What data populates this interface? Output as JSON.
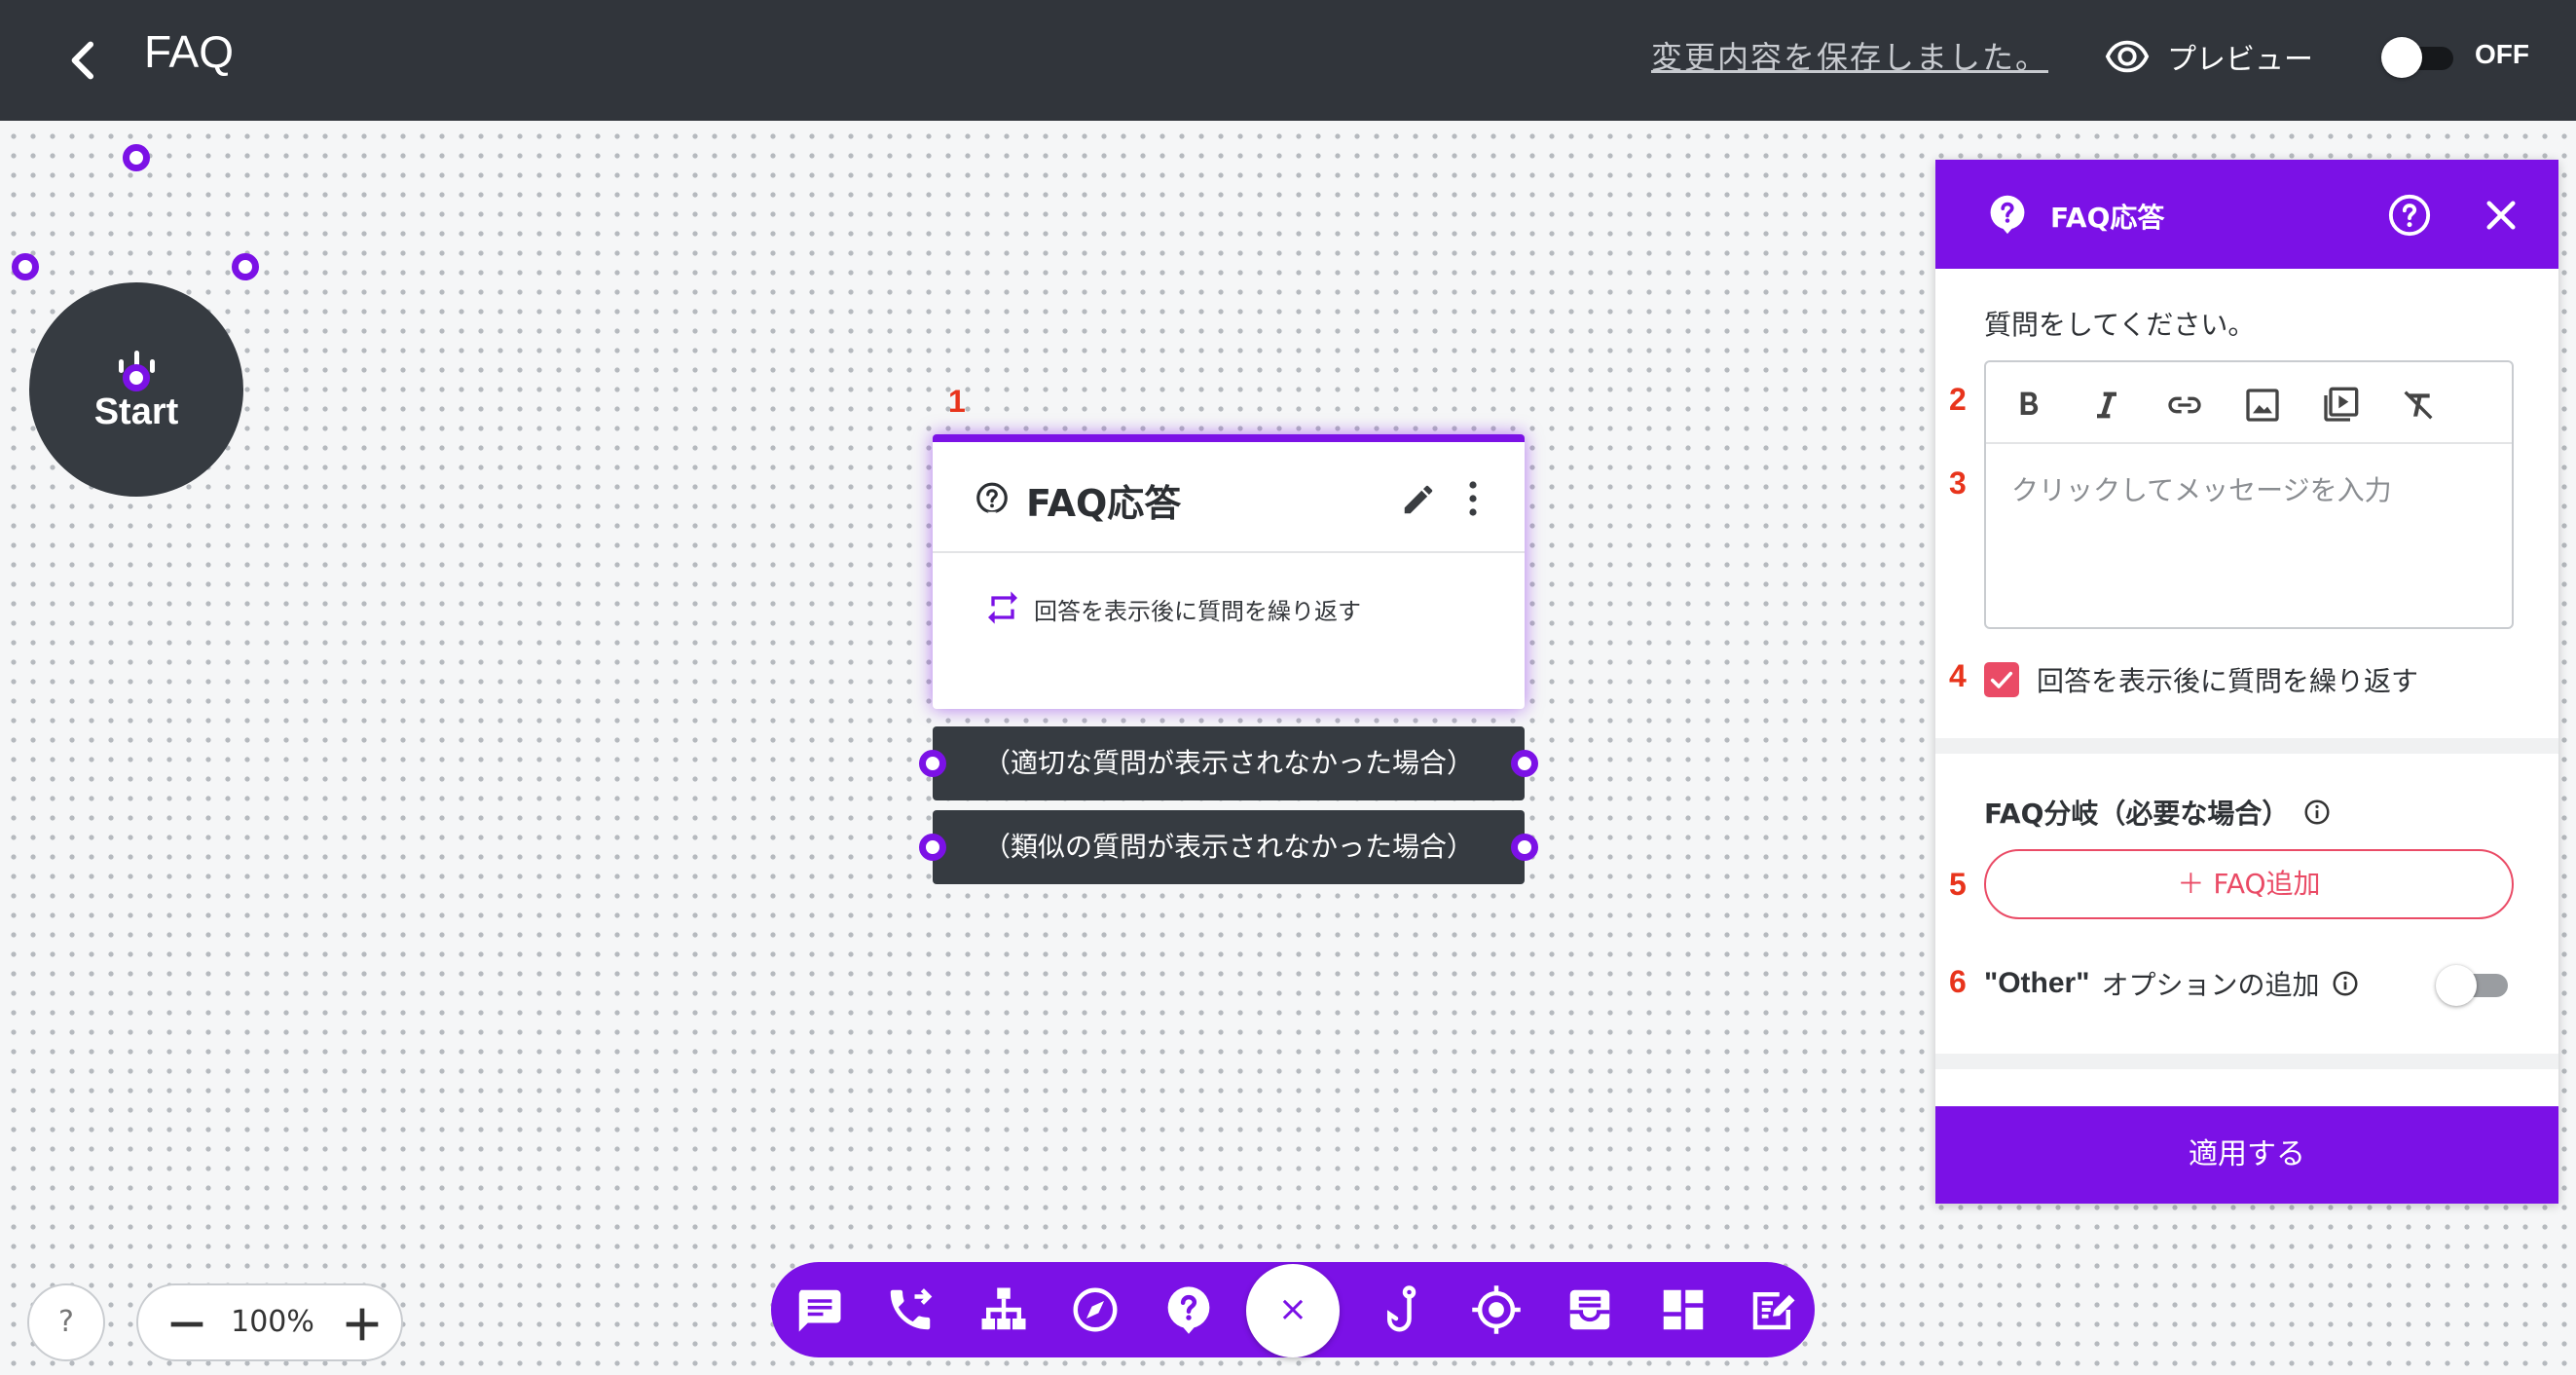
{
  "header": {
    "title": "FAQ",
    "save_status": "変更内容を保存しました。",
    "preview_label": "プレビュー",
    "toggle_label": "OFF"
  },
  "canvas": {
    "start_label": "Start",
    "node": {
      "number": "1",
      "title": "FAQ応答",
      "repeat_text": "回答を表示後に質問を繰り返す"
    },
    "branches": [
      "（適切な質問が表示されなかった場合）",
      "（類似の質問が表示されなかった場合）"
    ],
    "help_label": "?",
    "zoom_value": "100%"
  },
  "toolbar": {
    "close_label": "×",
    "icons": [
      "message-icon",
      "phone-forward-icon",
      "tree-icon",
      "compass-icon",
      "faq-icon",
      "hook-icon",
      "target-icon",
      "inbox-icon",
      "dashboard-icon",
      "form-edit-icon"
    ]
  },
  "panel": {
    "title": "FAQ応答",
    "prompt_label": "質問をしてください。",
    "editor_placeholder": "クリックしてメッセージを入力",
    "repeat_label": "回答を表示後に質問を繰り返す",
    "repeat_checked": true,
    "branch_section_label": "FAQ分岐（必要な場合）",
    "add_faq_label": "＋ FAQ追加",
    "other_quoted": "\"Other\"",
    "other_rest": "オプションの追加",
    "apply_label": "適用する",
    "annotations": [
      "2",
      "3",
      "4",
      "5",
      "6"
    ]
  },
  "colors": {
    "accent": "#7b11e6",
    "header_bg": "#31353b",
    "node_dark": "#363b41",
    "pink": "#ea4b66",
    "annotation": "#e8341c"
  }
}
